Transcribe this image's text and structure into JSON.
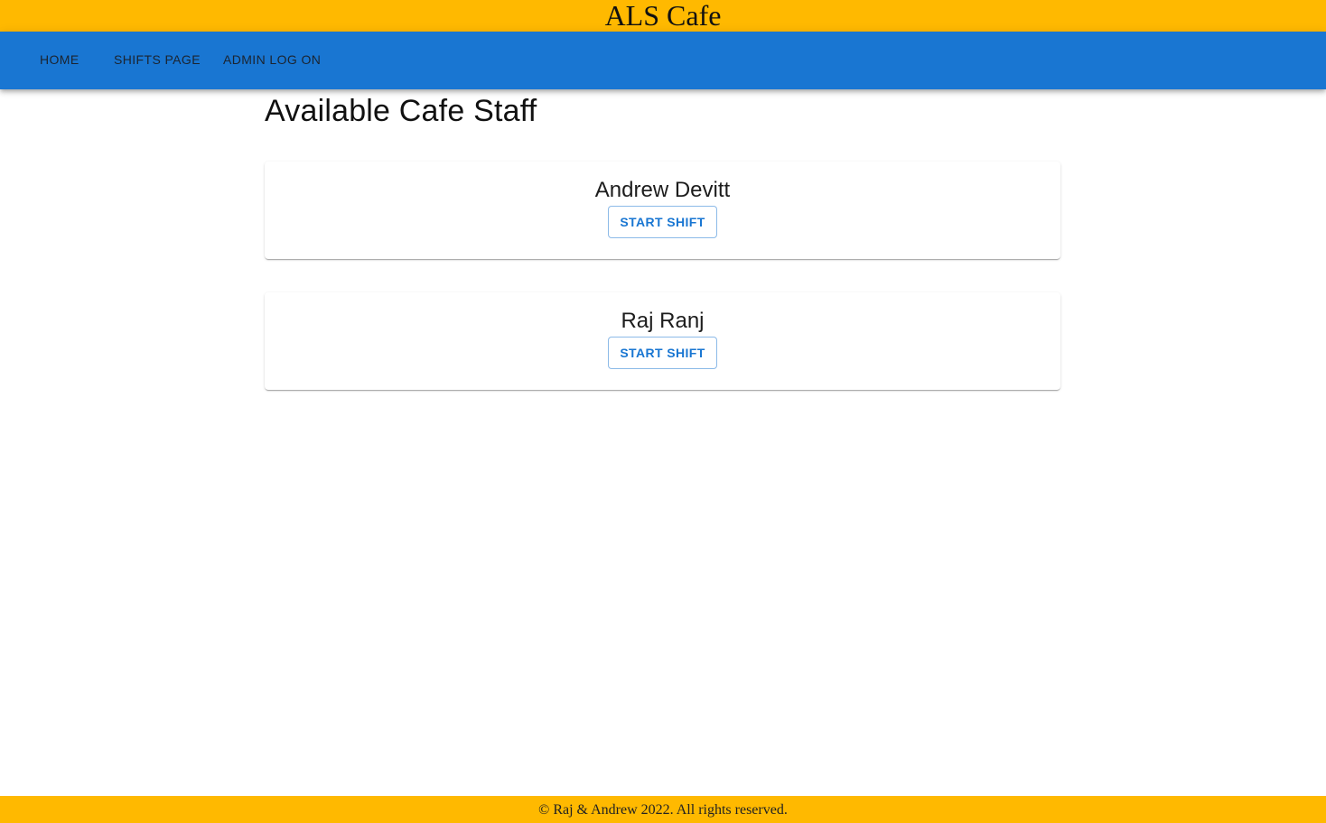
{
  "header": {
    "title": "ALS Cafe"
  },
  "nav": {
    "items": [
      {
        "label": "HOME"
      },
      {
        "label": "SHIFTS PAGE"
      },
      {
        "label": "ADMIN LOG ON"
      }
    ]
  },
  "main": {
    "title": "Available Cafe Staff",
    "staff": [
      {
        "name": "Andrew Devitt",
        "button_label": "START SHIFT"
      },
      {
        "name": "Raj Ranj",
        "button_label": "START SHIFT"
      }
    ]
  },
  "footer": {
    "text": "© Raj & Andrew 2022. All rights reserved."
  },
  "colors": {
    "banner": "#ffb900",
    "navbar": "#1976d2",
    "button_text": "#1976d2"
  }
}
